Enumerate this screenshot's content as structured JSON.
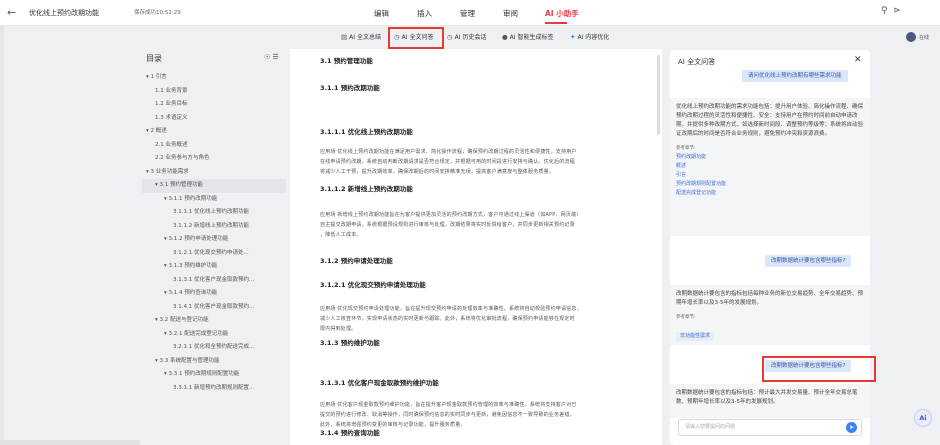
{
  "header": {
    "back_icon": "back-arrow-icon",
    "doc_title": "优化线上预约改期功能",
    "save_status": "保存成功10:52:29",
    "menus": [
      "编辑",
      "插入",
      "管理",
      "审阅",
      "AI 小助手"
    ],
    "active_menu": "AI 小助手",
    "icons": [
      "search-icon",
      "share-icon"
    ]
  },
  "toolbar": {
    "items": [
      "AI 全文总结",
      "AI 全文问答",
      "AI 历史会话",
      "AI 智能生成标签",
      "AI 内容优化"
    ],
    "highlighted": "AI 全文问答",
    "online_label": "在线"
  },
  "toc": {
    "title": "目录",
    "items": [
      "▾ 1 引言",
      "1.1 业务背景",
      "1.2 业务目标",
      "1.3 术语定义",
      "▾ 2 概述",
      "2.1 业务概述",
      "2.2 业务参与方与角色",
      "▾ 3 业务功能需求",
      "▾ 3.1 预约管理功能",
      "▾ 3.1.1 预约改期功能",
      "3.1.1.1 优化线上预约改期功能",
      "3.1.1.2 新增线上预约改期功能",
      "▾ 3.1.2 预约申请处理功能",
      "3.1.2.1 优化现交预约申请处...",
      "▾ 3.1.3 预约维护功能",
      "3.1.3.1 优化客户现金取款预约...",
      "▾ 3.1.4 预约查询功能",
      "3.1.4.1 优化客户现金取款预约...",
      "▾ 3.2 配送与登记功能",
      "▾ 3.2.1 配送完成登记功能",
      "3.2.1.1 优化和全预约配送完成...",
      "▾ 3.3 系统配置与管理功能",
      "▾ 3.3.1 预约改期规则配置功能",
      "3.3.1.1 新增预约改期规则配置..."
    ],
    "selected_index": 8
  },
  "document": {
    "blocks": [
      {
        "kind": "h",
        "text": "3.1 预约管理功能"
      },
      {
        "kind": "h",
        "text": "3.1.1 预约改期功能"
      },
      {
        "kind": "h",
        "text": "3.1.1.1 优化线上预约改期功能"
      },
      {
        "kind": "p",
        "lines": [
          "应用场 优化线上预约改期功能在满足用户需求、简化操作流程，确保预约改期过程的灵活性和便捷性。支持用户",
          "在线申请预约改期，系统自动判断改期请求是否符合规定，并根据可用的时间段进行安排与确认。优化后的流程",
          "将减少人工干预，提升改期效率，确保改期后的时间安排精准无误，提高客户满意度与整体服务质量。"
        ]
      },
      {
        "kind": "h",
        "text": "3.1.1.2 新增线上预约改期功能"
      },
      {
        "kind": "p",
        "lines": [
          "应用场 新增线上预约改期功能旨在为客户提供更加灵活的预约改期方式，客户可通过线上渠道（如APP、网页端）",
          "自主提交改期申请，系统根据预设规则进行审核与处理，改期结果将实时反馈给客户，并同步更新相关预约记录",
          "，降低人工成本。"
        ]
      },
      {
        "kind": "h",
        "text": "3.1.2 预约申请处理功能"
      },
      {
        "kind": "h",
        "text": "3.1.2.1 优化现交预约申请处理功能"
      },
      {
        "kind": "p",
        "lines": [
          "应用场 优化现交预约申请处理功能，旨在提升现交预约申请的处理效率与准确性。系统将自动校验预约申请信息，",
          "减少人工核查环节，实现申请状态的实时更新与跟踪。此外，系统将优化审批流程，确保预约申请能够在规定时",
          "限内得到处理。"
        ]
      },
      {
        "kind": "h",
        "text": "3.1.3 预约维护功能"
      },
      {
        "kind": "h",
        "text": "3.1.3.1 优化客户现金取款预约维护功能"
      },
      {
        "kind": "p",
        "lines": [
          "应用场 优化客户现金取款预约维护功能，旨在提升客户现金取款预约管理的效率与准确性。系统将支持客户对已",
          "提交的预约进行修改、取消等操作，同时确保预约信息的实时同步与更新，避免因信息不一致导致的业务差错。",
          "此外，系统将增强预约变更的审核与记录功能，提升服务质量。"
        ]
      },
      {
        "kind": "h",
        "text": "3.1.4 预约查询功能"
      }
    ]
  },
  "ai_panel": {
    "title": "AI 全文问答",
    "question1": "请问优化线上预约改期有哪些需求功能",
    "answer1": "优化线上预约改期功能的需求功能包括：提升用户体验、简化操作流程、确保预约改期过程的灵活性和便捷性、安全：支持用户在预约时间前自动申请改期，并提供多种改期方式，如选择新时间段、调整预约等级等；系统将自动验证改期后的时间是否符合业务规则，避免预约冲突和资源浪费。",
    "refs_label": "参考章节:",
    "refs1": [
      "预约改期功能",
      "概述",
      "引言",
      "预约改期规则配置功能",
      "配送完成登记功能"
    ],
    "question2": "改期数据统计要包含哪些指标?",
    "answer2": "改期数据统计要包含的指标包括每种业务的新位交易趋势、全年交易趋势、预期年增长率以及3-5年的发展规划。",
    "refs_label2": "参考章节:",
    "ref2": "非功能性需求",
    "question3": "改期数据统计要包含哪些指标?",
    "answer3": "改期数据统计要包含的指标包括：预计最大并发交易量、预计全年交易总笔数、预期年增长率以及3-5年的发展规划。",
    "input_placeholder": "请输入您要提问的问题",
    "send_icon": "send-icon"
  },
  "fab_label": "Ai",
  "colors": {
    "accent": "#e63946",
    "highlight_box": "#e53935",
    "link": "#3b6fd6",
    "bubble": "#dbe6fb"
  }
}
